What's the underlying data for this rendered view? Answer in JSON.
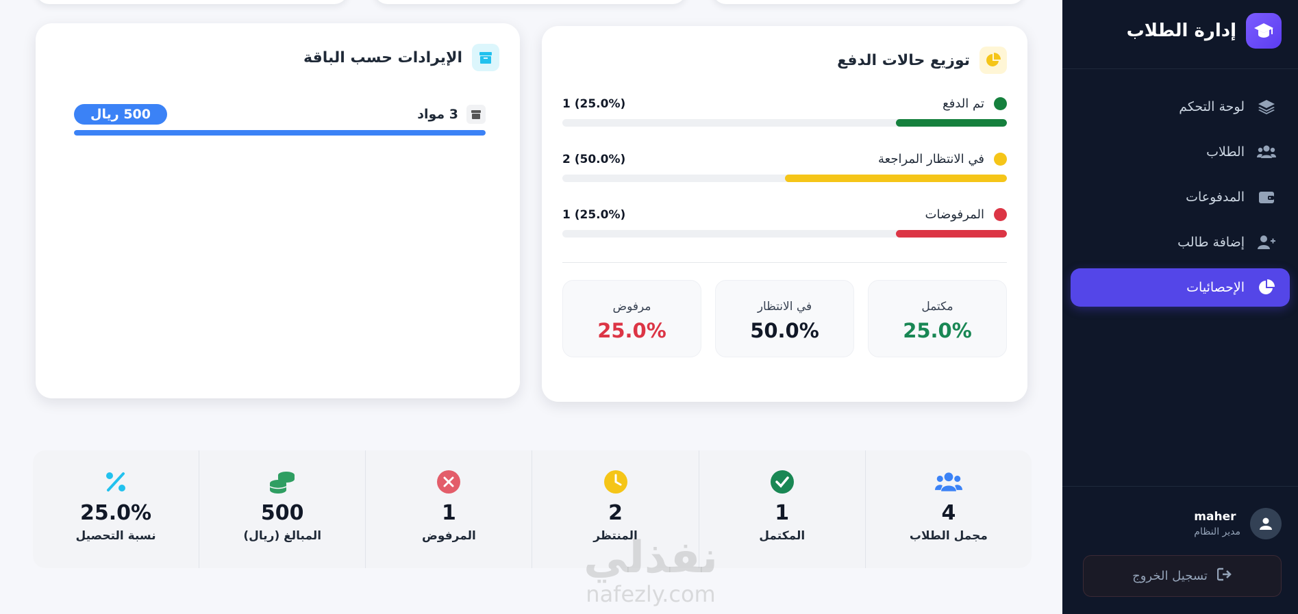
{
  "sidebar": {
    "brand_title": "إدارة الطلاب",
    "items": [
      {
        "label": "لوحة التحكم",
        "icon": "layers-icon"
      },
      {
        "label": "الطلاب",
        "icon": "users-icon"
      },
      {
        "label": "المدفوعات",
        "icon": "wallet-icon"
      },
      {
        "label": "إضافة طالب",
        "icon": "user-plus-icon"
      },
      {
        "label": "الإحصائيات",
        "icon": "chart-pie-icon"
      }
    ],
    "user": {
      "name": "maher",
      "role": "مدير النظام"
    },
    "logout_label": "تسجيل الخروج"
  },
  "distribution": {
    "title": "توزيع حالات الدفع",
    "rows": [
      {
        "label": "تم الدفع",
        "count": "1 (25.0%)",
        "percent": 25,
        "color": "#15803d"
      },
      {
        "label": "في الانتظار المراجعة",
        "count": "2 (50.0%)",
        "percent": 50,
        "color": "#f5c518"
      },
      {
        "label": "المرفوضات",
        "count": "1 (25.0%)",
        "percent": 25,
        "color": "#dc3545"
      }
    ],
    "stats": [
      {
        "label": "مكتمل",
        "value": "25.0%",
        "color": "#198754"
      },
      {
        "label": "في الانتظار",
        "value": "50.0%",
        "color": "#111827"
      },
      {
        "label": "مرفوض",
        "value": "25.0%",
        "color": "#dc3545"
      }
    ]
  },
  "revenue": {
    "title": "الإيرادات حسب الباقة",
    "items": [
      {
        "name": "3 مواد",
        "amount": "500 ريال",
        "percent": 100
      }
    ]
  },
  "summary": [
    {
      "value": "4",
      "label": "مجمل الطلاب",
      "icon": "users-icon",
      "color": "#3b82f6"
    },
    {
      "value": "1",
      "label": "المكتمل",
      "icon": "check-circle-icon",
      "color": "#198754"
    },
    {
      "value": "2",
      "label": "المنتظر",
      "icon": "clock-icon",
      "color": "#f5c518"
    },
    {
      "value": "1",
      "label": "المرفوض",
      "icon": "x-circle-icon",
      "color": "#dc3545"
    },
    {
      "value": "500",
      "label": "المبالغ (ريال)",
      "icon": "coins-icon",
      "color": "#198754"
    },
    {
      "value": "25.0%",
      "label": "نسبة التحصيل",
      "icon": "percent-icon",
      "color": "#22c1ee"
    }
  ],
  "watermark": {
    "ar": "نفذلي",
    "en": "nafezly.com"
  }
}
